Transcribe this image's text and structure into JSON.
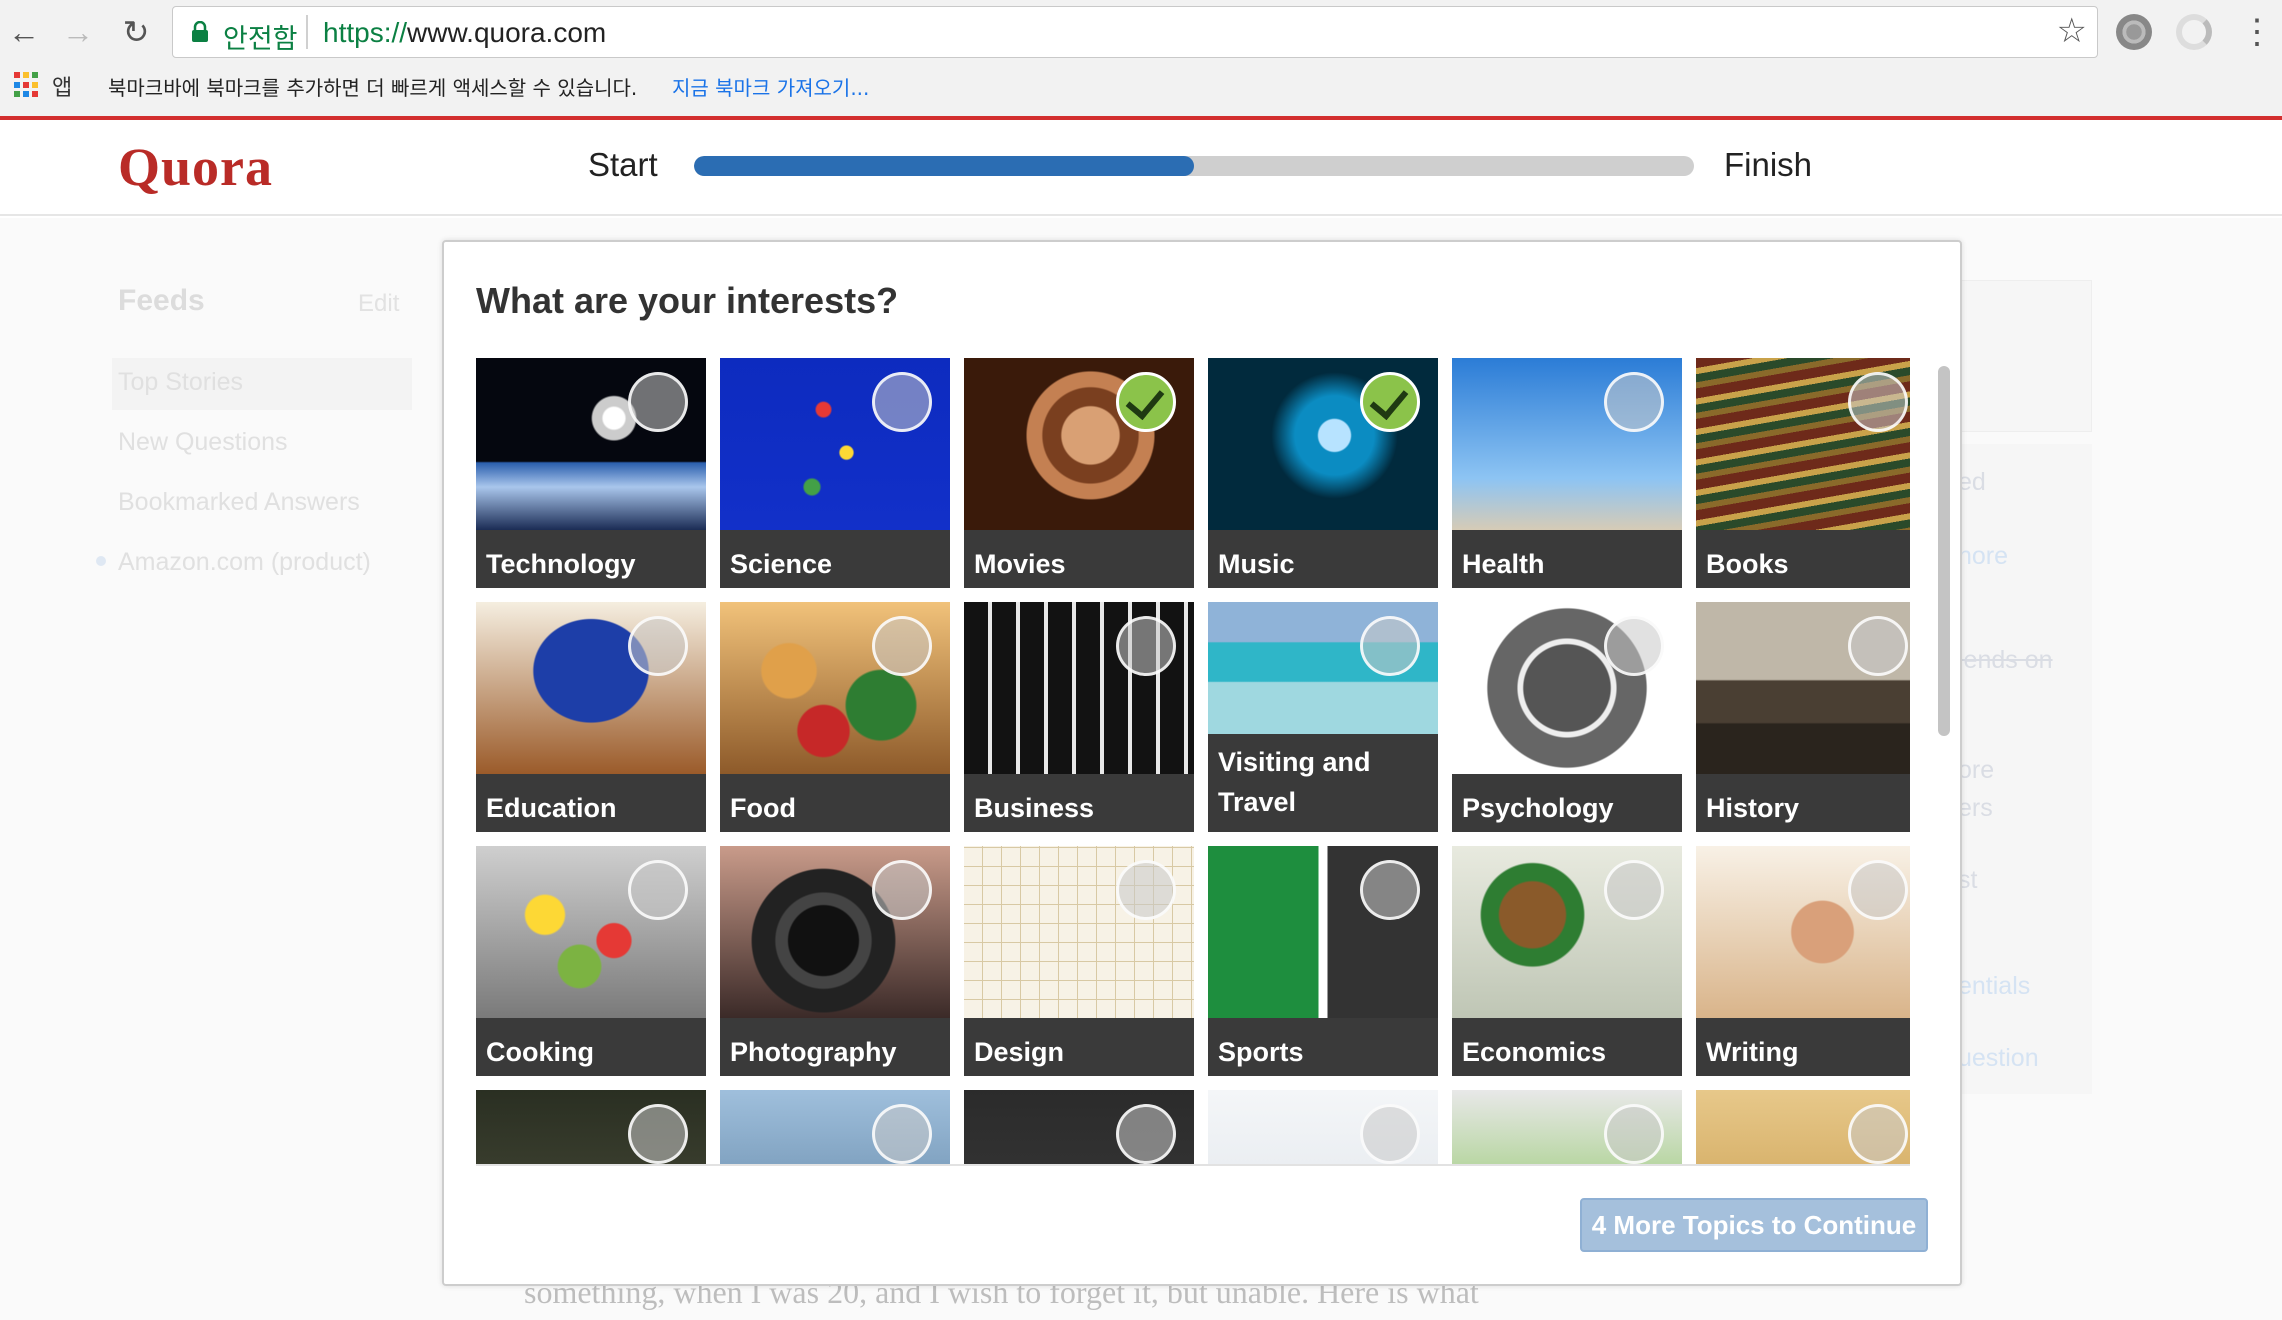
{
  "browser": {
    "secure_label": "안전함",
    "url_scheme": "https://",
    "url_host": "www.quora.com",
    "apps_label": "앱",
    "bookmark_message": "북마크바에 북마크를 추가하면 더 빠르게 액세스할 수 있습니다.",
    "bookmark_import_link": "지금 북마크 가져오기..."
  },
  "header": {
    "logo": "Quora",
    "start_label": "Start",
    "finish_label": "Finish",
    "progress_fraction": 0.5
  },
  "background": {
    "feeds_title": "Feeds",
    "feeds_edit": "Edit",
    "feed_items": [
      "Top Stories",
      "New Questions",
      "Bookmarked Answers",
      "Amazon.com (product)"
    ],
    "right_fragments": [
      "ed",
      "nore",
      "iends on",
      "ore",
      "ers",
      "st",
      "entials",
      "uestion"
    ],
    "bottom_text": "something, when I was 20, and I wish to forget it, but unable. Here is what"
  },
  "modal": {
    "title": "What are your interests?",
    "continue_label": "4 More Topics to Continue",
    "topics": [
      {
        "label": "Technology",
        "selected": false
      },
      {
        "label": "Science",
        "selected": false
      },
      {
        "label": "Movies",
        "selected": true
      },
      {
        "label": "Music",
        "selected": true
      },
      {
        "label": "Health",
        "selected": false
      },
      {
        "label": "Books",
        "selected": false
      },
      {
        "label": "Education",
        "selected": false
      },
      {
        "label": "Food",
        "selected": false
      },
      {
        "label": "Business",
        "selected": false
      },
      {
        "label": "Visiting and Travel",
        "selected": false
      },
      {
        "label": "Psychology",
        "selected": false
      },
      {
        "label": "History",
        "selected": false
      },
      {
        "label": "Cooking",
        "selected": false
      },
      {
        "label": "Photography",
        "selected": false
      },
      {
        "label": "Design",
        "selected": false
      },
      {
        "label": "Sports",
        "selected": false
      },
      {
        "label": "Economics",
        "selected": false
      },
      {
        "label": "Writing",
        "selected": false
      },
      {
        "label": "",
        "selected": false
      },
      {
        "label": "",
        "selected": false
      },
      {
        "label": "",
        "selected": false
      },
      {
        "label": "",
        "selected": false
      },
      {
        "label": "",
        "selected": false
      },
      {
        "label": "",
        "selected": false
      }
    ]
  },
  "colors": {
    "quora_red": "#b92b27",
    "progress_blue": "#2b6db3",
    "selected_check": "#8bc34a",
    "button_disabled": "#a5c0dc"
  }
}
